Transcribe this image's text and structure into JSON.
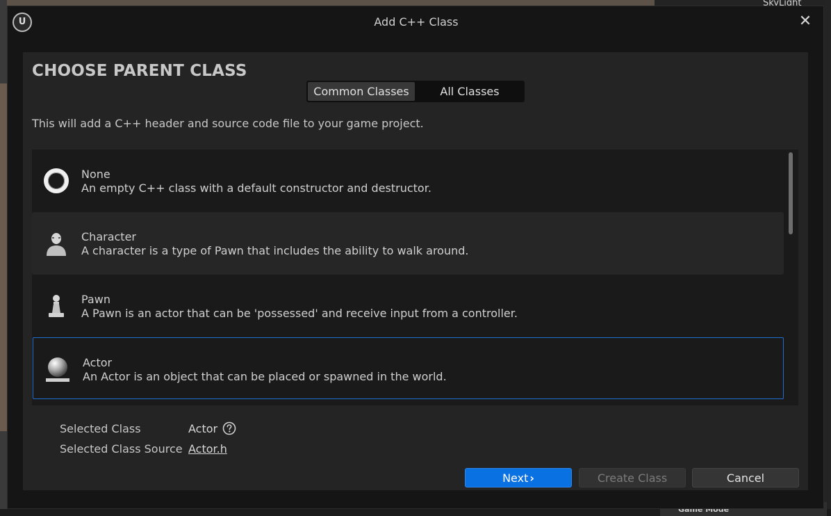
{
  "background": {
    "top_right_text": "SkyLight",
    "bottom_right_text": "Game Mode"
  },
  "window": {
    "title": "Add C++ Class",
    "close_glyph": "✕",
    "logo_glyph": "U"
  },
  "panel": {
    "heading": "CHOOSE PARENT CLASS",
    "description": "This will add a C++ header and source code file to your game project.",
    "tabs": [
      {
        "label": "Common Classes",
        "active": true
      },
      {
        "label": "All Classes",
        "active": false
      }
    ]
  },
  "classes": [
    {
      "name": "None",
      "description": "An empty C++ class with a default constructor and destructor.",
      "icon": "none-class-icon"
    },
    {
      "name": "Character",
      "description": "A character is a type of Pawn that includes the ability to walk around.",
      "icon": "character-class-icon"
    },
    {
      "name": "Pawn",
      "description": "A Pawn is an actor that can be 'possessed' and receive input from a controller.",
      "icon": "pawn-class-icon"
    },
    {
      "name": "Actor",
      "description": "An Actor is an object that can be placed or spawned in the world.",
      "icon": "actor-class-icon"
    }
  ],
  "selection": {
    "class_label": "Selected Class",
    "class_value": "Actor",
    "source_label": "Selected Class Source",
    "source_value": "Actor.h"
  },
  "buttons": {
    "next": "Next",
    "next_glyph": "›",
    "create": "Create Class",
    "cancel": "Cancel"
  },
  "colors": {
    "accent": "#0a71e3",
    "selection_border": "#1f6fd1"
  }
}
